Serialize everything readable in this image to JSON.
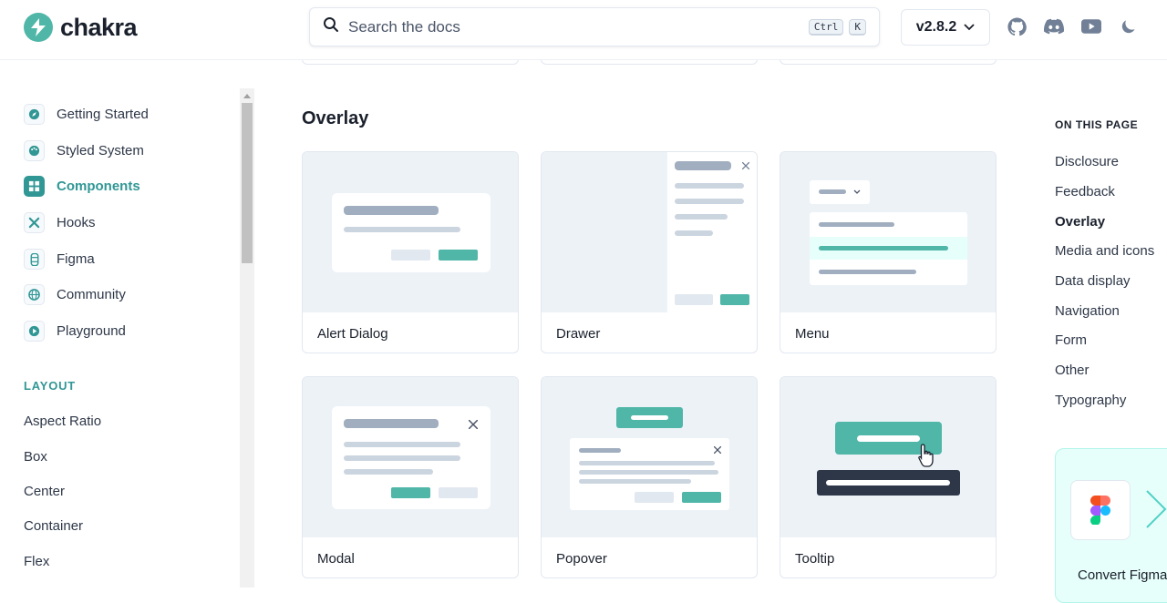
{
  "header": {
    "logo_text": "chakra",
    "search_placeholder": "Search the docs",
    "kbd_ctrl": "Ctrl",
    "kbd_k": "K",
    "version": "v2.8.2",
    "icons": [
      "github-icon",
      "discord-icon",
      "youtube-icon",
      "moon-icon"
    ]
  },
  "sidebar": {
    "items": [
      {
        "label": "Getting Started",
        "icon": "compass-icon"
      },
      {
        "label": "Styled System",
        "icon": "palette-icon"
      },
      {
        "label": "Components",
        "icon": "grid-icon",
        "active": true
      },
      {
        "label": "Hooks",
        "icon": "tools-icon"
      },
      {
        "label": "Figma",
        "icon": "figma-icon"
      },
      {
        "label": "Community",
        "icon": "globe-icon"
      },
      {
        "label": "Playground",
        "icon": "play-icon"
      }
    ],
    "section_title": "LAYOUT",
    "layout_items": [
      "Aspect Ratio",
      "Box",
      "Center",
      "Container",
      "Flex"
    ]
  },
  "main": {
    "section_heading": "Overlay",
    "cards": [
      "Alert Dialog",
      "Drawer",
      "Menu",
      "Modal",
      "Popover",
      "Tooltip"
    ]
  },
  "toc": {
    "title": "ON THIS PAGE",
    "items": [
      "Disclosure",
      "Feedback",
      "Overlay",
      "Media and icons",
      "Data display",
      "Navigation",
      "Form",
      "Other",
      "Typography"
    ],
    "active": "Overlay"
  },
  "promo": {
    "text": "Convert Figma"
  },
  "colors": {
    "accent": "#319795",
    "teal_bar": "#4fb6a8",
    "preview_bg": "#edf2f7",
    "gray_bar": "#a0aec0"
  }
}
